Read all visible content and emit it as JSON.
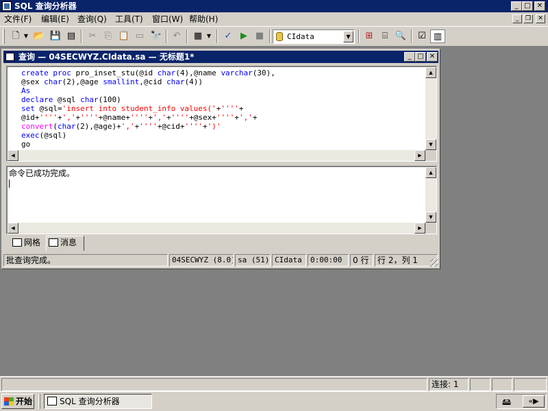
{
  "app": {
    "title": "SQL 查询分析器"
  },
  "menu": {
    "items": [
      "文件(F)",
      "编辑(E)",
      "查询(Q)",
      "工具(T)",
      "窗口(W)",
      "帮助(H)"
    ]
  },
  "toolbar": {
    "database": "CIdata",
    "buttons": [
      "new-query",
      "open",
      "save",
      "load-script",
      "cut",
      "copy",
      "paste",
      "clear-window",
      "find",
      "undo",
      "results-mode",
      "parse",
      "execute",
      "cancel",
      "object-browser",
      "object-search",
      "show-plan",
      "options",
      "results-pane"
    ]
  },
  "query_window": {
    "title": "查询 — 04SECWYZ.CIdata.sa — 无标题1*",
    "code_lines": [
      [
        {
          "t": "create proc ",
          "c": "kw"
        },
        {
          "t": "pro_inset_stu(@id ",
          "c": ""
        },
        {
          "t": "char",
          "c": "kw"
        },
        {
          "t": "(4),@name ",
          "c": ""
        },
        {
          "t": "varchar",
          "c": "kw"
        },
        {
          "t": "(30),",
          "c": ""
        }
      ],
      [
        {
          "t": "@sex ",
          "c": ""
        },
        {
          "t": "char",
          "c": "kw"
        },
        {
          "t": "(2),@age ",
          "c": ""
        },
        {
          "t": "smallint",
          "c": "kw"
        },
        {
          "t": ",@cid ",
          "c": ""
        },
        {
          "t": "char",
          "c": "kw"
        },
        {
          "t": "(4))",
          "c": ""
        }
      ],
      [
        {
          "t": "As",
          "c": "kw"
        }
      ],
      [
        {
          "t": "declare ",
          "c": "kw"
        },
        {
          "t": "@sql ",
          "c": ""
        },
        {
          "t": "char",
          "c": "kw"
        },
        {
          "t": "(100)",
          "c": ""
        }
      ],
      [
        {
          "t": "set ",
          "c": "kw"
        },
        {
          "t": "@sql=",
          "c": ""
        },
        {
          "t": "'insert into student_info values('",
          "c": "str"
        },
        {
          "t": "+",
          "c": ""
        },
        {
          "t": "''''",
          "c": "str"
        },
        {
          "t": "+",
          "c": ""
        }
      ],
      [
        {
          "t": "@id+",
          "c": ""
        },
        {
          "t": "''''",
          "c": "str"
        },
        {
          "t": "+",
          "c": ""
        },
        {
          "t": "','",
          "c": "str"
        },
        {
          "t": "+",
          "c": ""
        },
        {
          "t": "''''",
          "c": "str"
        },
        {
          "t": "+@name+",
          "c": ""
        },
        {
          "t": "''''",
          "c": "str"
        },
        {
          "t": "+",
          "c": ""
        },
        {
          "t": "','",
          "c": "str"
        },
        {
          "t": "+",
          "c": ""
        },
        {
          "t": "''''",
          "c": "str"
        },
        {
          "t": "+@sex+",
          "c": ""
        },
        {
          "t": "''''",
          "c": "str"
        },
        {
          "t": "+",
          "c": ""
        },
        {
          "t": "','",
          "c": "str"
        },
        {
          "t": "+",
          "c": ""
        }
      ],
      [
        {
          "t": "convert",
          "c": "fn"
        },
        {
          "t": "(",
          "c": ""
        },
        {
          "t": "char",
          "c": "kw"
        },
        {
          "t": "(2),@age)+",
          "c": ""
        },
        {
          "t": "','",
          "c": "str"
        },
        {
          "t": "+",
          "c": ""
        },
        {
          "t": "''''",
          "c": "str"
        },
        {
          "t": "+@cid+",
          "c": ""
        },
        {
          "t": "''''",
          "c": "str"
        },
        {
          "t": "+",
          "c": ""
        },
        {
          "t": "')'",
          "c": "str"
        }
      ],
      [
        {
          "t": "exec",
          "c": "kw"
        },
        {
          "t": "(@sql)",
          "c": ""
        }
      ],
      [
        {
          "t": "go",
          "c": ""
        }
      ]
    ],
    "message": "命令已成功完成。",
    "tabs": {
      "grid": "网格",
      "messages": "消息"
    },
    "status": {
      "text": "批查询完成。",
      "server": "04SECWYZ (8.0)",
      "user": "sa (51)",
      "database": "CIdata",
      "elapsed": "0:00:00",
      "rows": "0 行",
      "position": "行 2，列 1"
    }
  },
  "app_status": {
    "connections": "连接: 1"
  },
  "taskbar": {
    "start": "开始",
    "task": "SQL 查询分析器"
  },
  "colors": {
    "titlebar": "#0a246a",
    "face": "#d4d0c8",
    "desktop": "#808080",
    "keyword": "#0000ff",
    "string": "#ff0000",
    "function": "#ff00ff"
  }
}
